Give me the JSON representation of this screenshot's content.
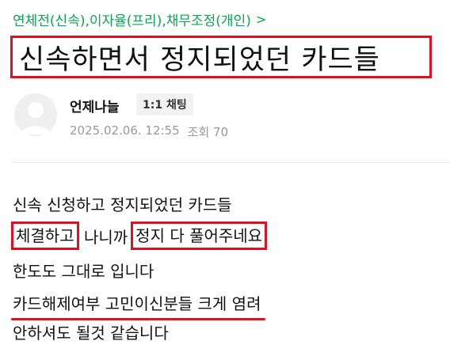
{
  "category": {
    "label": "연체전(신속),이자율(프리),채무조정(개인)",
    "chevron": ">"
  },
  "post": {
    "title": "신속하면서 정지되었던 카드들",
    "author": "언제나늘",
    "chat_label": "1:1 채팅",
    "date": "2025.02.06. 12:55",
    "views_label": "조회 70"
  },
  "body": {
    "line1": "신속 신청하고 정지되었던 카드들",
    "line2_boxed_a": "체결하고",
    "line2_mid": " 나니까",
    "line2_boxed_b": "정지 다 풀어주네요",
    "line3": "한도도 그대로 입니다",
    "line4": "카드해제여부 고민이신분들 크게 염려",
    "line5": "안하셔도 될것 같습니다"
  },
  "colors": {
    "accent_green": "#03a94d",
    "highlight_red": "#e0101f"
  }
}
